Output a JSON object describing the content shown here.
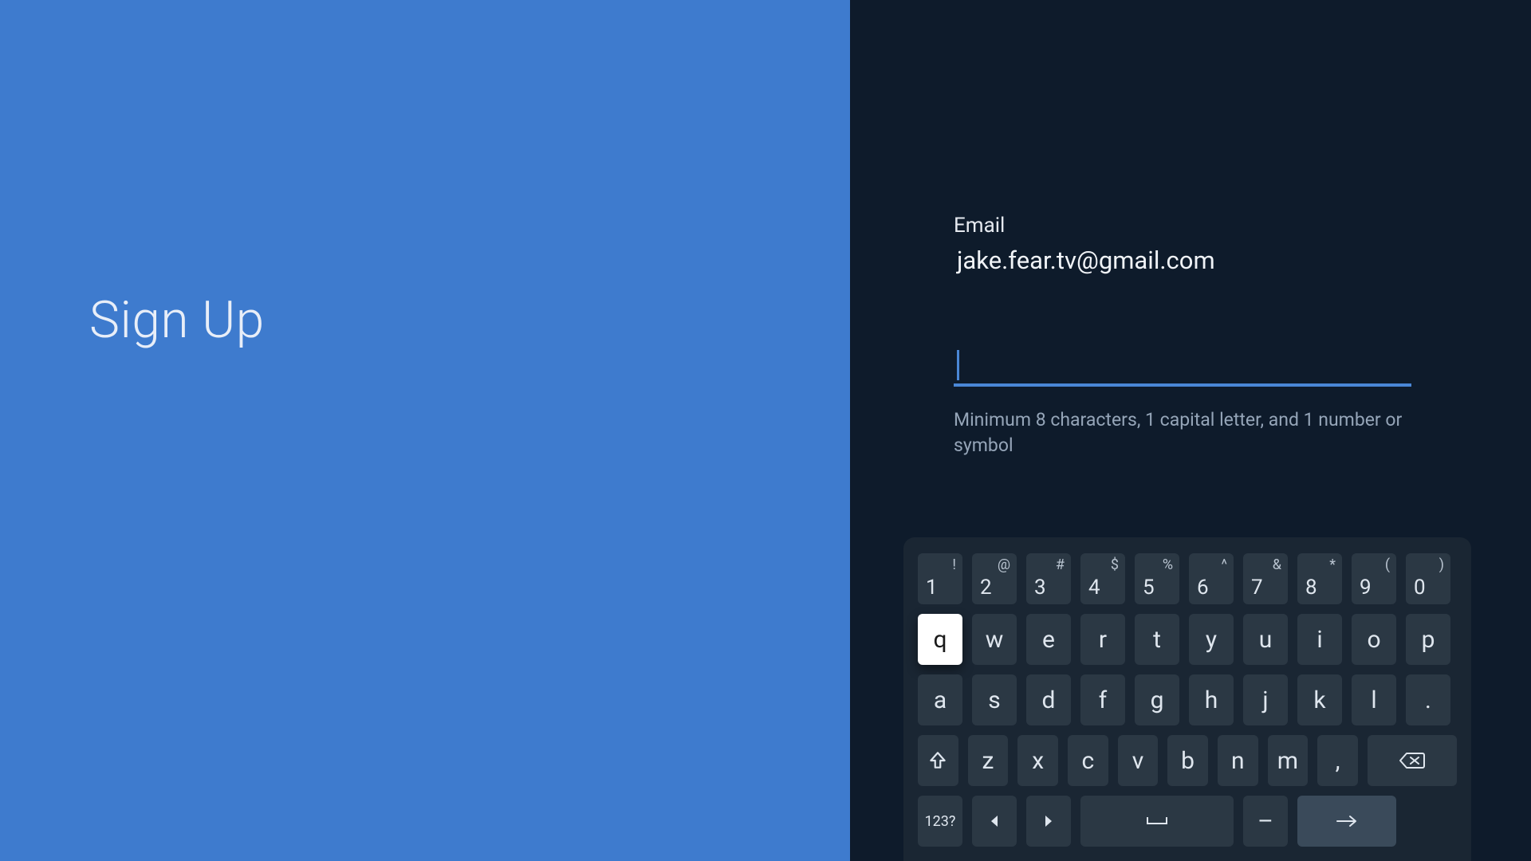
{
  "colors": {
    "left_bg": "#3e7bce",
    "right_bg": "#0e1b2b",
    "accent": "#4a87d6"
  },
  "left": {
    "title": "Sign Up"
  },
  "form": {
    "email_label": "Email",
    "email_value": "jake.fear.tv@gmail.com",
    "password_value": "",
    "password_hint": "Minimum 8 characters, 1 capital letter, and 1 number or symbol"
  },
  "keyboard": {
    "mode_label": "123?",
    "focused_key": "q",
    "row_numbers": [
      {
        "p": "1",
        "s": "!"
      },
      {
        "p": "2",
        "s": "@"
      },
      {
        "p": "3",
        "s": "#"
      },
      {
        "p": "4",
        "s": "$"
      },
      {
        "p": "5",
        "s": "%"
      },
      {
        "p": "6",
        "s": "^"
      },
      {
        "p": "7",
        "s": "&"
      },
      {
        "p": "8",
        "s": "*"
      },
      {
        "p": "9",
        "s": "("
      },
      {
        "p": "0",
        "s": ")"
      }
    ],
    "row_q": [
      "q",
      "w",
      "e",
      "r",
      "t",
      "y",
      "u",
      "i",
      "o",
      "p"
    ],
    "row_a": [
      "a",
      "s",
      "d",
      "f",
      "g",
      "h",
      "j",
      "k",
      "l",
      "."
    ],
    "row_z_mid": [
      "z",
      "x",
      "c",
      "v",
      "b",
      "n",
      "m",
      ","
    ],
    "row_bottom": {
      "dash": "–"
    },
    "icons": {
      "shift": "shift-icon",
      "backspace": "backspace-icon",
      "left": "arrow-left-icon",
      "right": "arrow-right-icon",
      "space": "space-icon",
      "enter": "arrow-right-long-icon"
    }
  }
}
